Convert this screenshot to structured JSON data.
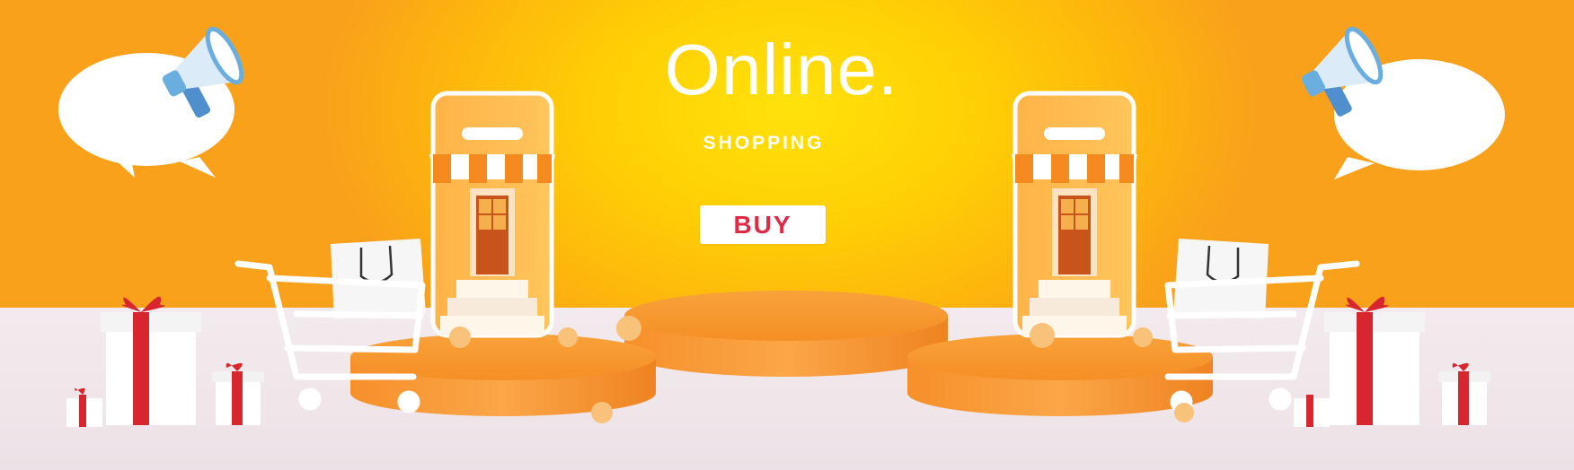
{
  "banner": {
    "headline": "Online.",
    "subheadline": "SHOPPING",
    "cta_label": "BUY"
  },
  "colors": {
    "background_center": "#ffe20a",
    "background_edge": "#f9a11b",
    "floor": "#f0e6ea",
    "podium": "#f7962c",
    "awning_orange": "#f58a1f",
    "ribbon_red": "#d7262e",
    "megaphone_blue": "#6aaee0",
    "cta_text": "#e02a45"
  },
  "icons": [
    "megaphone-icon",
    "speech-bubble-icon",
    "phone-store-icon",
    "shopping-bag-icon",
    "shopping-cart-icon",
    "gift-box-icon",
    "podium-icon"
  ]
}
